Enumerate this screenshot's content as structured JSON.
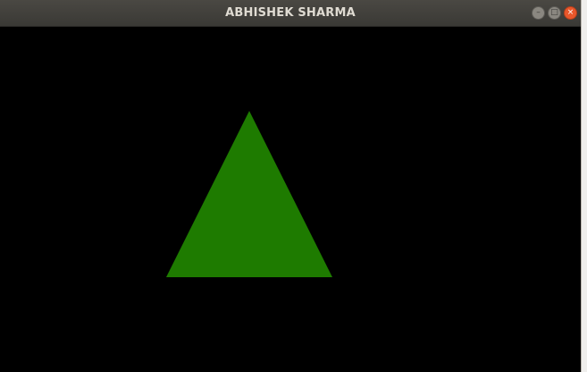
{
  "window": {
    "title": "ABHISHEK SHARMA",
    "controls": [
      {
        "name": "minimize",
        "glyph": "–"
      },
      {
        "name": "maximize",
        "glyph": "□"
      },
      {
        "name": "close",
        "glyph": "×"
      }
    ]
  },
  "canvas": {
    "background": "#000000",
    "shape": {
      "type": "triangle",
      "fill": "#1e7b00"
    }
  }
}
